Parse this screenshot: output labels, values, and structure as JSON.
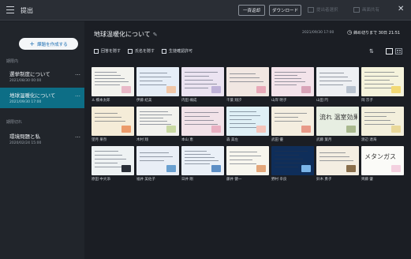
{
  "topbar": {
    "title": "提出",
    "collect_all": "一斉返却",
    "download": "ダウンロード",
    "ghost1": "提出者選択",
    "ghost2": "画面共有",
    "icons": {
      "menu": "hamburger-menu-icon",
      "close": "close-icon"
    }
  },
  "sidebar": {
    "create": "課題を作成する",
    "section_open": "期限内",
    "section_closed": "期限切れ",
    "items": [
      {
        "title": "選挙制度について",
        "date": "2021/08/30 00:00",
        "active": false
      },
      {
        "title": "地球温暖化について",
        "date": "2021/09/30 17:00",
        "active": true
      },
      {
        "title": "環境問題と私",
        "date": "2020/02/24 15:00",
        "active": false
      }
    ],
    "more": "…"
  },
  "main": {
    "topic": "地球温暖化について",
    "stamp": "2021/09/30 17:00",
    "deadline": "締め切りまで 30日 21:51",
    "checks": [
      "回答を隠す",
      "氏名を隠す",
      "生徒確認許可"
    ],
    "cards": [
      {
        "name": "橋本太郎",
        "bg": "#f3f3ee",
        "acc": "#e9b9c7",
        "person": true
      },
      {
        "name": "伊藤 結美",
        "bg": "#e6eef7",
        "acc": "#f0c7a8"
      },
      {
        "name": "内田 颯成",
        "bg": "#ebe3f1",
        "acc": "#bfb2d8"
      },
      {
        "name": "千葉 翔汐",
        "bg": "#f1e7e2",
        "acc": "#e8a9b8"
      },
      {
        "name": "山岸 明子",
        "bg": "#f3e3ea",
        "acc": "#d9a4b8"
      },
      {
        "name": "山田 円",
        "bg": "#eef0f3",
        "acc": "#b9c3cf"
      },
      {
        "name": "岡 京子",
        "bg": "#f5f3dc",
        "acc": "#f2d974"
      },
      {
        "name": "望月 果奈",
        "bg": "#f5ecd8",
        "acc": "#ec9b6a"
      },
      {
        "name": "木村 翔",
        "bg": "#f2f2ee",
        "acc": "#c9d9a3"
      },
      {
        "name": "本山 恵",
        "bg": "#f1e2e8",
        "acc": "#e9b0c2"
      },
      {
        "name": "森 美左",
        "bg": "#dff0f6",
        "acc": "#f4c5bb"
      },
      {
        "name": "武田 優",
        "bg": "#f4eee0",
        "acc": "#e89a88"
      },
      {
        "name": "武藤 葉月",
        "bg": "#e7eee2",
        "acc": "#a9b98e",
        "big": "流れ 温室効果"
      },
      {
        "name": "渡辺 達海",
        "bg": "#f3efdc",
        "acc": "#e9d89a"
      },
      {
        "name": "原田 中大添",
        "bg": "#eef2f3",
        "acc": "#2a2f38"
      },
      {
        "name": "福井 美佐子",
        "bg": "#e9eef6",
        "acc": "#6aa0d0"
      },
      {
        "name": "日井 剛",
        "bg": "#eaf0f7",
        "acc": "#5d8fc5"
      },
      {
        "name": "藤井 健一",
        "bg": "#f7f6ee",
        "acc": "#e3a77a"
      },
      {
        "name": "野村 幸良",
        "bg": "#0f2e5a",
        "acc": "#7bb5e8"
      },
      {
        "name": "鈴木 勇子",
        "bg": "#f4eee2",
        "acc": "#8a6f4c"
      },
      {
        "name": "齊藤 肇",
        "bg": "#fbfbf8",
        "acc": "#f4d1e0",
        "big": "メタンガス"
      }
    ]
  },
  "colors": {
    "accent": "#0d6e86",
    "bg": "#1b1e24",
    "sidebar": "#21252b"
  }
}
